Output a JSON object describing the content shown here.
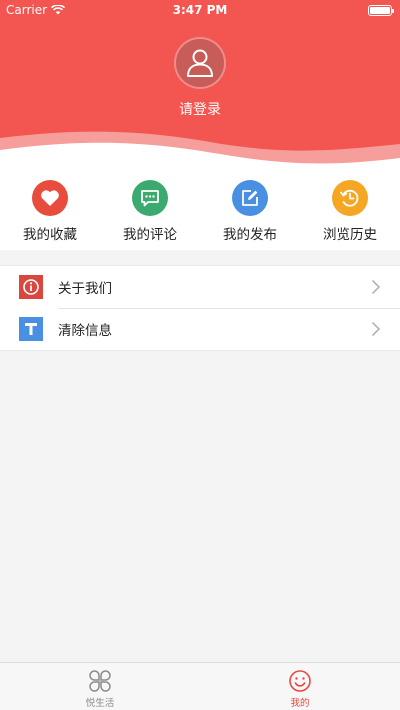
{
  "status_bar": {
    "carrier": "Carrier",
    "time": "3:47 PM"
  },
  "profile": {
    "login_text": "请登录"
  },
  "quick_actions": [
    {
      "label": "我的收藏",
      "icon": "heart-icon",
      "color": "#e74c3c"
    },
    {
      "label": "我的评论",
      "icon": "comment-icon",
      "color": "#3aaa6e"
    },
    {
      "label": "我的发布",
      "icon": "edit-icon",
      "color": "#4a90e2"
    },
    {
      "label": "浏览历史",
      "icon": "history-icon",
      "color": "#f5a623"
    }
  ],
  "menu": [
    {
      "label": "关于我们",
      "icon": "info-icon",
      "color": "#d9473f"
    },
    {
      "label": "清除信息",
      "icon": "text-t-icon",
      "color": "#4a90e2"
    }
  ],
  "tabs": [
    {
      "label": "悦生活",
      "icon": "clover-icon",
      "active": false
    },
    {
      "label": "我的",
      "icon": "smiley-icon",
      "active": true
    }
  ],
  "colors": {
    "header": "#f35550",
    "active_tab": "#e94841",
    "inactive_tab": "#8a8a8a"
  }
}
